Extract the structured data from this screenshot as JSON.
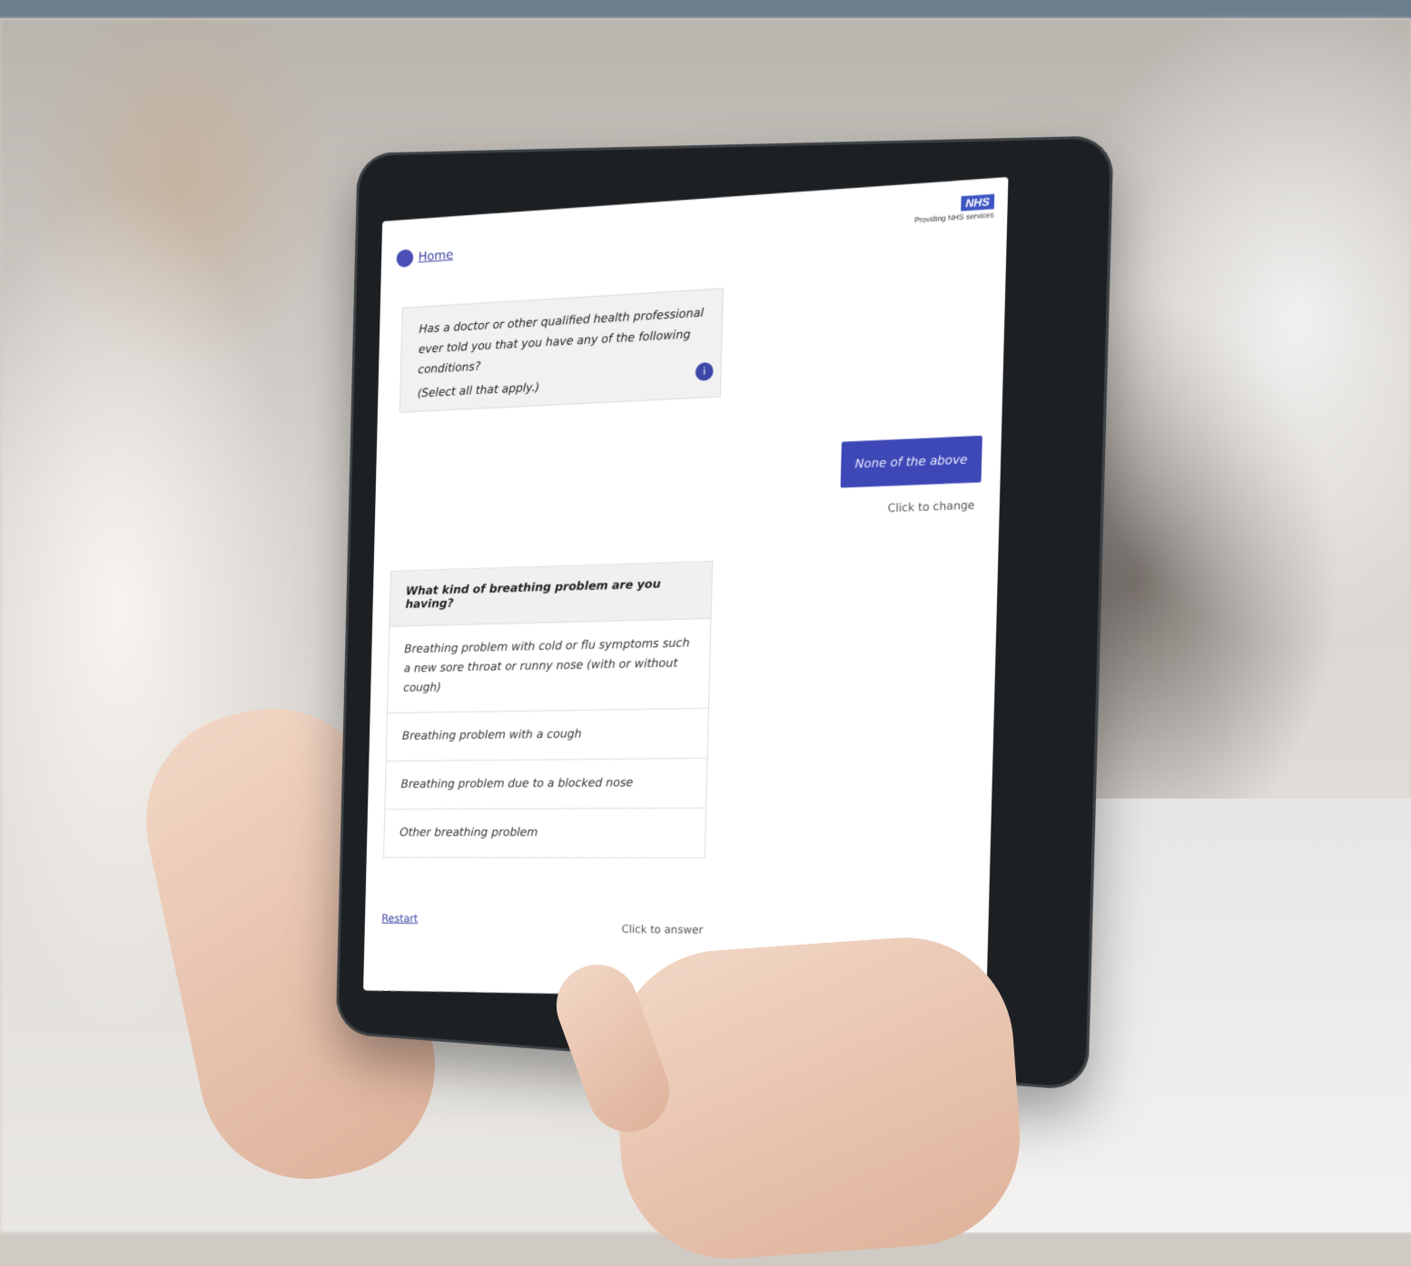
{
  "screen": {
    "home_label": "Home",
    "nhs_logo": "NHS",
    "nhs_tagline": "Providing NHS services",
    "bot_question": "Has a doctor or other qualified health professional ever told you that you have any of the following conditions?",
    "bot_hint": "(Select all that apply.)",
    "info_icon": "i",
    "user_answer": "None of the above",
    "change_label": "Click to change",
    "current_question": "What kind of breathing problem are you having?",
    "options": [
      "Breathing problem with cold or flu symptoms such a new sore throat or runny nose (with or without cough)",
      "Breathing problem with a cough",
      "Breathing problem due to a blocked nose",
      "Other breathing problem"
    ],
    "restart_label": "Restart",
    "answer_hint": "Click to answer"
  },
  "colors": {
    "accent": "#3d47b6",
    "link": "#3b3fa2"
  }
}
